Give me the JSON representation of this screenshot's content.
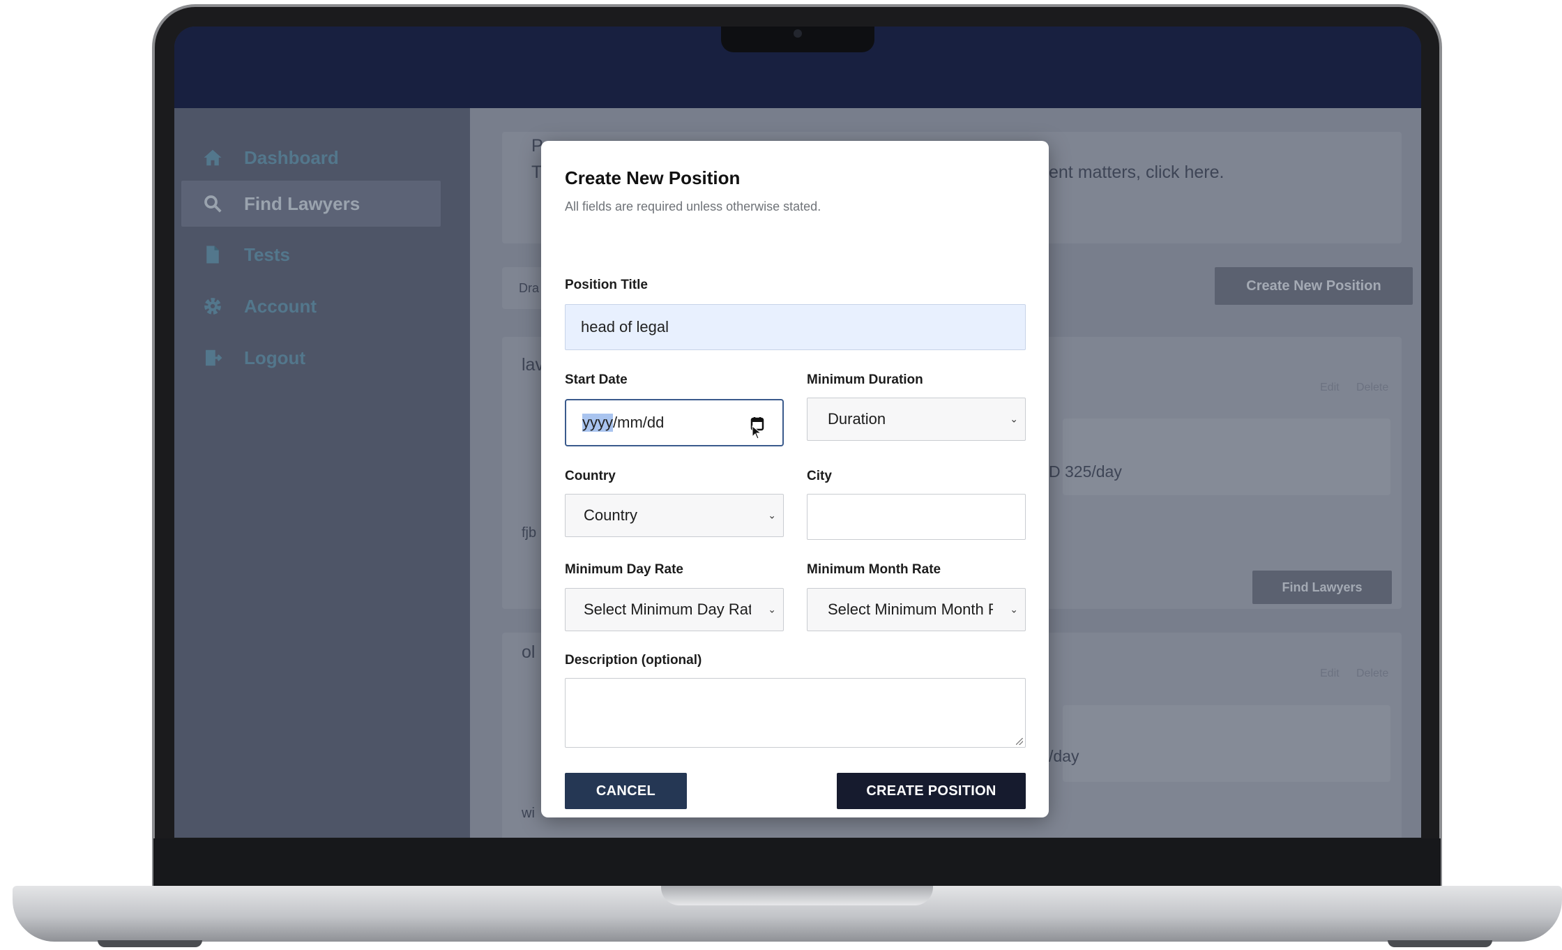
{
  "sidebar": {
    "items": [
      {
        "label": "Dashboard",
        "icon": "home-icon"
      },
      {
        "label": "Find Lawyers",
        "icon": "search-icon",
        "active": true
      },
      {
        "label": "Tests",
        "icon": "document-icon"
      },
      {
        "label": "Account",
        "icon": "gear-icon"
      },
      {
        "label": "Logout",
        "icon": "logout-icon"
      }
    ]
  },
  "background": {
    "intro_partial": "ent matters, click here.",
    "create_new_position_label": "Create New Position",
    "draft_partial": "Dra",
    "position1_partial": "lav",
    "position1_rate_partial": "D 325/day",
    "position1_note_partial": "fjb",
    "find_lawyers_label": "Find Lawyers",
    "edit_label": "Edit",
    "delete_label": "Delete",
    "position2_partial": "ol",
    "position2_rate_partial": "/day",
    "position2_note_partial": "wi",
    "heading_partial_p": "P",
    "heading_partial_t": "T"
  },
  "modal": {
    "title": "Create New Position",
    "subtitle": "All fields are required unless otherwise stated.",
    "position_title": {
      "label": "Position Title",
      "value": "head of legal"
    },
    "start_date": {
      "label": "Start Date",
      "value_highlight": "yyyy",
      "value_rest": "/mm/dd"
    },
    "minimum_duration": {
      "label": "Minimum Duration",
      "value": "Duration"
    },
    "country": {
      "label": "Country",
      "value": "Country"
    },
    "city": {
      "label": "City",
      "value": ""
    },
    "min_day_rate": {
      "label": "Minimum Day Rate",
      "value": "Select Minimum Day Rate"
    },
    "min_month_rate": {
      "label": "Minimum Month Rate",
      "value": "Select Minimum Month Rate"
    },
    "description": {
      "label": "Description (optional)",
      "value": ""
    },
    "cancel_label": "CANCEL",
    "create_label": "CREATE POSITION"
  }
}
